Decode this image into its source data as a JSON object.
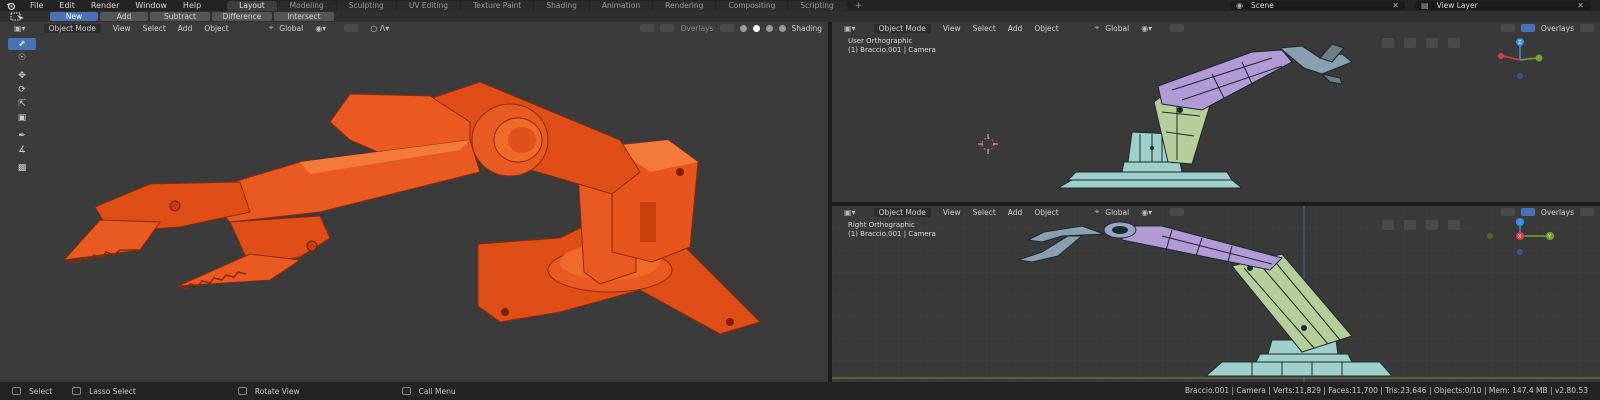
{
  "menu": [
    "File",
    "Edit",
    "Render",
    "Window",
    "Help"
  ],
  "workspaces": [
    {
      "label": "Layout",
      "active": true
    },
    {
      "label": "Modeling",
      "active": false
    },
    {
      "label": "Sculpting",
      "active": false
    },
    {
      "label": "UV Editing",
      "active": false
    },
    {
      "label": "Texture Paint",
      "active": false
    },
    {
      "label": "Shading",
      "active": false
    },
    {
      "label": "Animation",
      "active": false
    },
    {
      "label": "Rendering",
      "active": false
    },
    {
      "label": "Compositing",
      "active": false
    },
    {
      "label": "Scripting",
      "active": false
    }
  ],
  "workspace_add": "+",
  "scene": {
    "label": "Scene"
  },
  "view_layer": {
    "label": "View Layer"
  },
  "boolean_ops": [
    {
      "label": "New",
      "selected": true
    },
    {
      "label": "Add",
      "selected": false
    },
    {
      "label": "Subtract",
      "selected": false
    },
    {
      "label": "Difference",
      "selected": false
    },
    {
      "label": "Intersect",
      "selected": false
    }
  ],
  "main_viewport": {
    "mode": "Object Mode",
    "menus": [
      "View",
      "Select",
      "Add",
      "Object"
    ],
    "transform": "Global",
    "overlays": "Overlays",
    "shading": "Shading"
  },
  "upper_right": {
    "mode": "Object Mode",
    "menus": [
      "View",
      "Select",
      "Add",
      "Object"
    ],
    "transform": "Global",
    "overlays": "Overlays",
    "view_name": "User Orthographic",
    "object_info": "(1) Braccio.001 | Camera"
  },
  "lower_right": {
    "mode": "Object Mode",
    "menus": [
      "View",
      "Select",
      "Add",
      "Object"
    ],
    "transform": "Global",
    "overlays": "Overlays",
    "view_name": "Right Orthographic",
    "object_info": "(1) Braccio.001 | Camera"
  },
  "status": {
    "select": "Select",
    "lasso": "Lasso Select",
    "rotate": "Rotate View",
    "call_menu": "Call Menu",
    "stats": "Braccio.001 | Camera | Verts:11,829 | Faces:11,700 | Tris:23,646 | Objects:0/10 | Mem: 147.4 MB | v2.80.53"
  },
  "gizmo": {
    "z": "Z",
    "x": "X",
    "y": "Y"
  },
  "colors": {
    "model_orange": "#e8521c",
    "arm_purple": "#b19ad6",
    "arm_green": "#b6cf9a",
    "base_cyan": "#9fd0cc",
    "accent_blue": "#4772b3"
  }
}
